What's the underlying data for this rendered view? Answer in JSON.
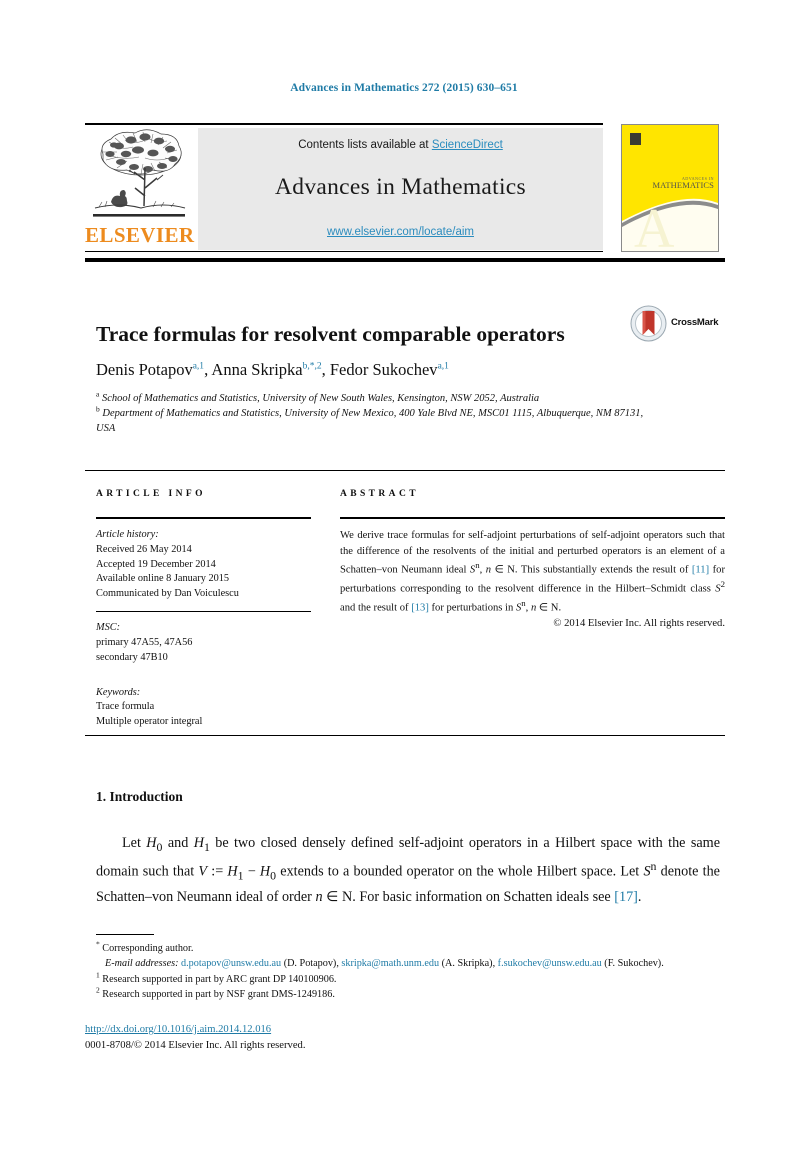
{
  "running_head": "Advances in Mathematics 272 (2015) 630–651",
  "masthead": {
    "publisher_wordmark": "ELSEVIER",
    "contents_prefix": "Contents lists available at ",
    "contents_link": "ScienceDirect",
    "journal_name": "Advances in Mathematics",
    "journal_url": "www.elsevier.com/locate/aim",
    "cover_title_small": "ADVANCES IN",
    "cover_title_big": "MATHEMATICS"
  },
  "article": {
    "title": "Trace formulas for resolvent comparable operators",
    "crossmark_label": "CrossMark",
    "authors_html": "Denis Potapov<sup>a,1</sup>, Anna Skripka<sup>b,*,2</sup>, Fedor Sukochev<sup>a,1</sup>",
    "affiliation_a": "School of Mathematics and Statistics, University of New South Wales, Kensington, NSW 2052, Australia",
    "affiliation_b": "Department of Mathematics and Statistics, University of New Mexico, 400 Yale Blvd NE, MSC01 1115, Albuquerque, NM 87131, USA"
  },
  "info": {
    "heading": "ARTICLE INFO",
    "history_label": "Article history:",
    "history": [
      "Received 26 May 2014",
      "Accepted 19 December 2014",
      "Available online 8 January 2015",
      "Communicated by Dan Voiculescu"
    ],
    "msc_label": "MSC:",
    "msc": [
      "primary 47A55, 47A56",
      "secondary 47B10"
    ],
    "keywords_label": "Keywords:",
    "keywords": [
      "Trace formula",
      "Multiple operator integral"
    ]
  },
  "abstract": {
    "heading": "ABSTRACT",
    "body_html": "We derive trace formulas for self-adjoint perturbations of self-adjoint operators such that the difference of the resolvents of the initial and perturbed operators is an element of a Schatten–von Neumann ideal <span class=\"cal\">S</span><sup>n</sup>, <span class=\"mathi\">n</span> ∈ N. This substantially extends the result of <span class=\"ref\">[11]</span> for perturbations corresponding to the resolvent difference in the Hilbert–Schmidt class <span class=\"cal\">S</span><sup>2</sup> and the result of <span class=\"ref\">[13]</span> for perturbations in <span class=\"cal\">S</span><sup>n</sup>, <span class=\"mathi\">n</span> ∈ N.",
    "copyright": "© 2014 Elsevier Inc. All rights reserved."
  },
  "body": {
    "section_number_title": "1.  Introduction",
    "paragraph_html": "Let <span class=\"mathi\">H</span><sub>0</sub> and <span class=\"mathi\">H</span><sub>1</sub> be two closed densely defined self-adjoint operators in a Hilbert space with the same domain such that <span class=\"mathi\">V</span> := <span class=\"mathi\">H</span><sub>1</sub> − <span class=\"mathi\">H</span><sub>0</sub> extends to a bounded operator on the whole Hilbert space. Let <span class=\"cal\">S</span><sup>n</sup> denote the Schatten–von Neumann ideal of order <span class=\"mathi\">n</span> ∈ N. For basic information on Schatten ideals see <span class=\"ref\">[17]</span>."
  },
  "footnotes": {
    "corresponding": "Corresponding author.",
    "email_label": "E-mail addresses:",
    "emails_html": "<span class=\"mail\">d.potapov@unsw.edu.au</span> (D. Potapov), <span class=\"mail\">skripka@math.unm.edu</span> (A. Skripka), <span class=\"mail\">f.sukochev@unsw.edu.au</span> (F. Sukochev).",
    "note1": "Research supported in part by ARC grant DP 140100906.",
    "note2": "Research supported in part by NSF grant DMS-1249186."
  },
  "footer": {
    "doi_url": "http://dx.doi.org/10.1016/j.aim.2014.12.016",
    "issn_copyright": "0001-8708/© 2014 Elsevier Inc. All rights reserved."
  },
  "colors": {
    "link_teal": "#1f7ba6",
    "sd_blue": "#2b8cbe",
    "elsevier_orange": "#ED8B1E",
    "cover_yellow": "#FFE500"
  }
}
